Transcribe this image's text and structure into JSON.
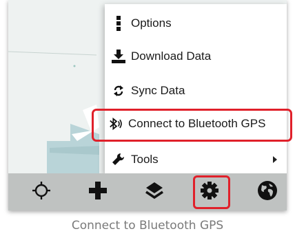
{
  "menu": {
    "items": [
      {
        "label": "Options",
        "icon": "vertical-dots-icon"
      },
      {
        "label": "Download Data",
        "icon": "download-icon"
      },
      {
        "label": "Sync Data",
        "icon": "sync-icon"
      },
      {
        "label": "Connect to Bluetooth GPS",
        "icon": "bluetooth-icon",
        "highlighted": true
      },
      {
        "label": "Tools",
        "icon": "wrench-icon",
        "has_submenu": true
      }
    ]
  },
  "toolbar": {
    "buttons": [
      {
        "icon": "crosshair-icon"
      },
      {
        "icon": "plus-icon"
      },
      {
        "icon": "layers-icon"
      },
      {
        "icon": "gear-icon",
        "highlighted": true
      },
      {
        "icon": "globe-icon"
      }
    ]
  },
  "caption": "Connect to Bluetooth GPS",
  "colors": {
    "highlight": "#e0202a",
    "toolbar_bg": "#bfc2c1",
    "map_bg": "#eef2f1",
    "caption_text": "#7a7a7a"
  }
}
